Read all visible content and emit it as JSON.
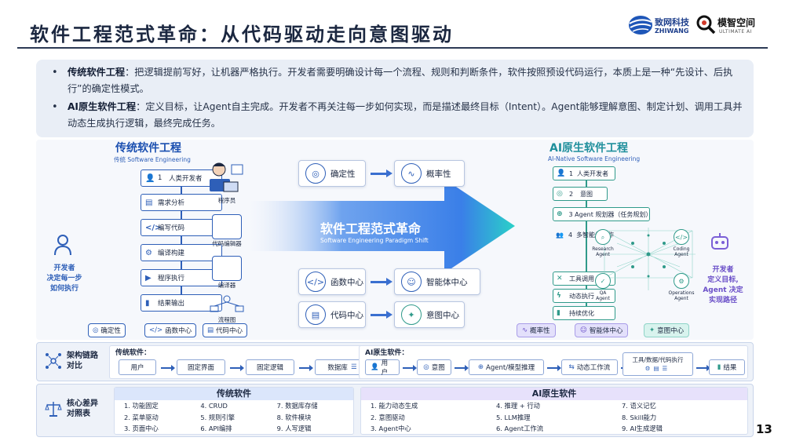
{
  "title": "软件工程范式革命：从代码驱动走向意图驱动",
  "logos": {
    "zhiwang_cn": "致网科技",
    "zhiwang_en": "ZHIWANG",
    "mozhi_cn": "模智空间",
    "mozhi_en": "ULTIMATE AI"
  },
  "summary": [
    {
      "term": "传统软件工程",
      "text": "：把逻辑提前写好，让机器严格执行。开发者需要明确设计每一个流程、规则和判断条件，软件按照预设代码运行，本质上是一种“先设计、后执行”的确定性模式。"
    },
    {
      "term": "AI原生软件工程",
      "text": "：定义目标，让Agent自主完成。开发者不再关注每一步如何实现，而是描述最终目标（Intent）。Agent能够理解意图、制定计划、调用工具并动态生成执行逻辑，最终完成任务。"
    }
  ],
  "left": {
    "title": "传统软件工程",
    "subtitle": "传统 Software Engineering",
    "dev_caption": "开发者\n决定每一步\n如何执行",
    "steps": [
      {
        "num": "1",
        "label": "人类开发者",
        "icon": "user-icon"
      },
      {
        "num": "",
        "label": "需求分析",
        "icon": "doc-icon"
      },
      {
        "num": "",
        "label": "编写代码",
        "icon": "code-icon"
      },
      {
        "num": "",
        "label": "编译构建",
        "icon": "gear-icon"
      },
      {
        "num": "",
        "label": "程序执行",
        "icon": "play-icon"
      },
      {
        "num": "",
        "label": "结果输出",
        "icon": "chart-icon"
      }
    ],
    "tools": [
      "程序员",
      "代码编辑器",
      "编译器",
      "流程图"
    ],
    "tags": [
      "确定性",
      "函数中心",
      "代码中心"
    ]
  },
  "center": {
    "banner_title": "软件工程范式革命",
    "banner_sub": "Software Engineering Paradigm Shift",
    "pairs": [
      {
        "from": "确定性",
        "to": "概率性"
      },
      {
        "from": "函数中心",
        "to": "智能体中心"
      },
      {
        "from": "代码中心",
        "to": "意图中心"
      }
    ]
  },
  "right": {
    "title": "AI原生软件工程",
    "subtitle": "AI-Native Software Engineering",
    "dev_caption": "开发者\n定义目标,\nAgent 决定\n实现路径",
    "steps": [
      {
        "num": "1",
        "label": "人类开发者"
      },
      {
        "num": "2",
        "label": "意图"
      },
      {
        "num": "3",
        "label": "Agent 规划器（任务规划）"
      },
      {
        "num": "4",
        "label": "多智能体协作"
      },
      {
        "num": "",
        "label": "工具调用"
      },
      {
        "num": "",
        "label": "动态执行"
      },
      {
        "num": "",
        "label": "持续优化"
      }
    ],
    "agents": [
      {
        "label": "Research\nAgent"
      },
      {
        "label": "Coding\nAgent"
      },
      {
        "label": "QA\nAgent"
      },
      {
        "label": "Operations\nAgent"
      }
    ],
    "tags": [
      "概率性",
      "智能体中心",
      "意图中心"
    ]
  },
  "arch": {
    "label": "架构链路\n对比",
    "trad_title": "传统软件：",
    "trad": [
      "用户",
      "固定界面",
      "固定逻辑",
      "数据库"
    ],
    "ai_title": "AI原生软件：",
    "ai": [
      "用户",
      "意图",
      "Agent/模型推理",
      "动态工作流",
      "工具/数据/代码执行",
      "结果"
    ]
  },
  "compare": {
    "label": "核心差异\n对照表",
    "trad_title": "传统软件",
    "trad": [
      "1. 功能固定",
      "4. CRUD",
      "7. 数据库存储",
      "2. 菜单驱动",
      "5. 规则引擎",
      "8. 软件模块",
      "3. 页面中心",
      "6. API编排",
      "9. 人写逻辑"
    ],
    "ai_title": "AI原生软件",
    "ai": [
      "1. 能力动态生成",
      "4. 推理 + 行动",
      "7. 语义记忆",
      "2. 意图驱动",
      "5. LLM推理",
      "8. Skill能力",
      "3. Agent中心",
      "6. Agent工作流",
      "9. AI生成逻辑"
    ]
  },
  "page_number": "13"
}
